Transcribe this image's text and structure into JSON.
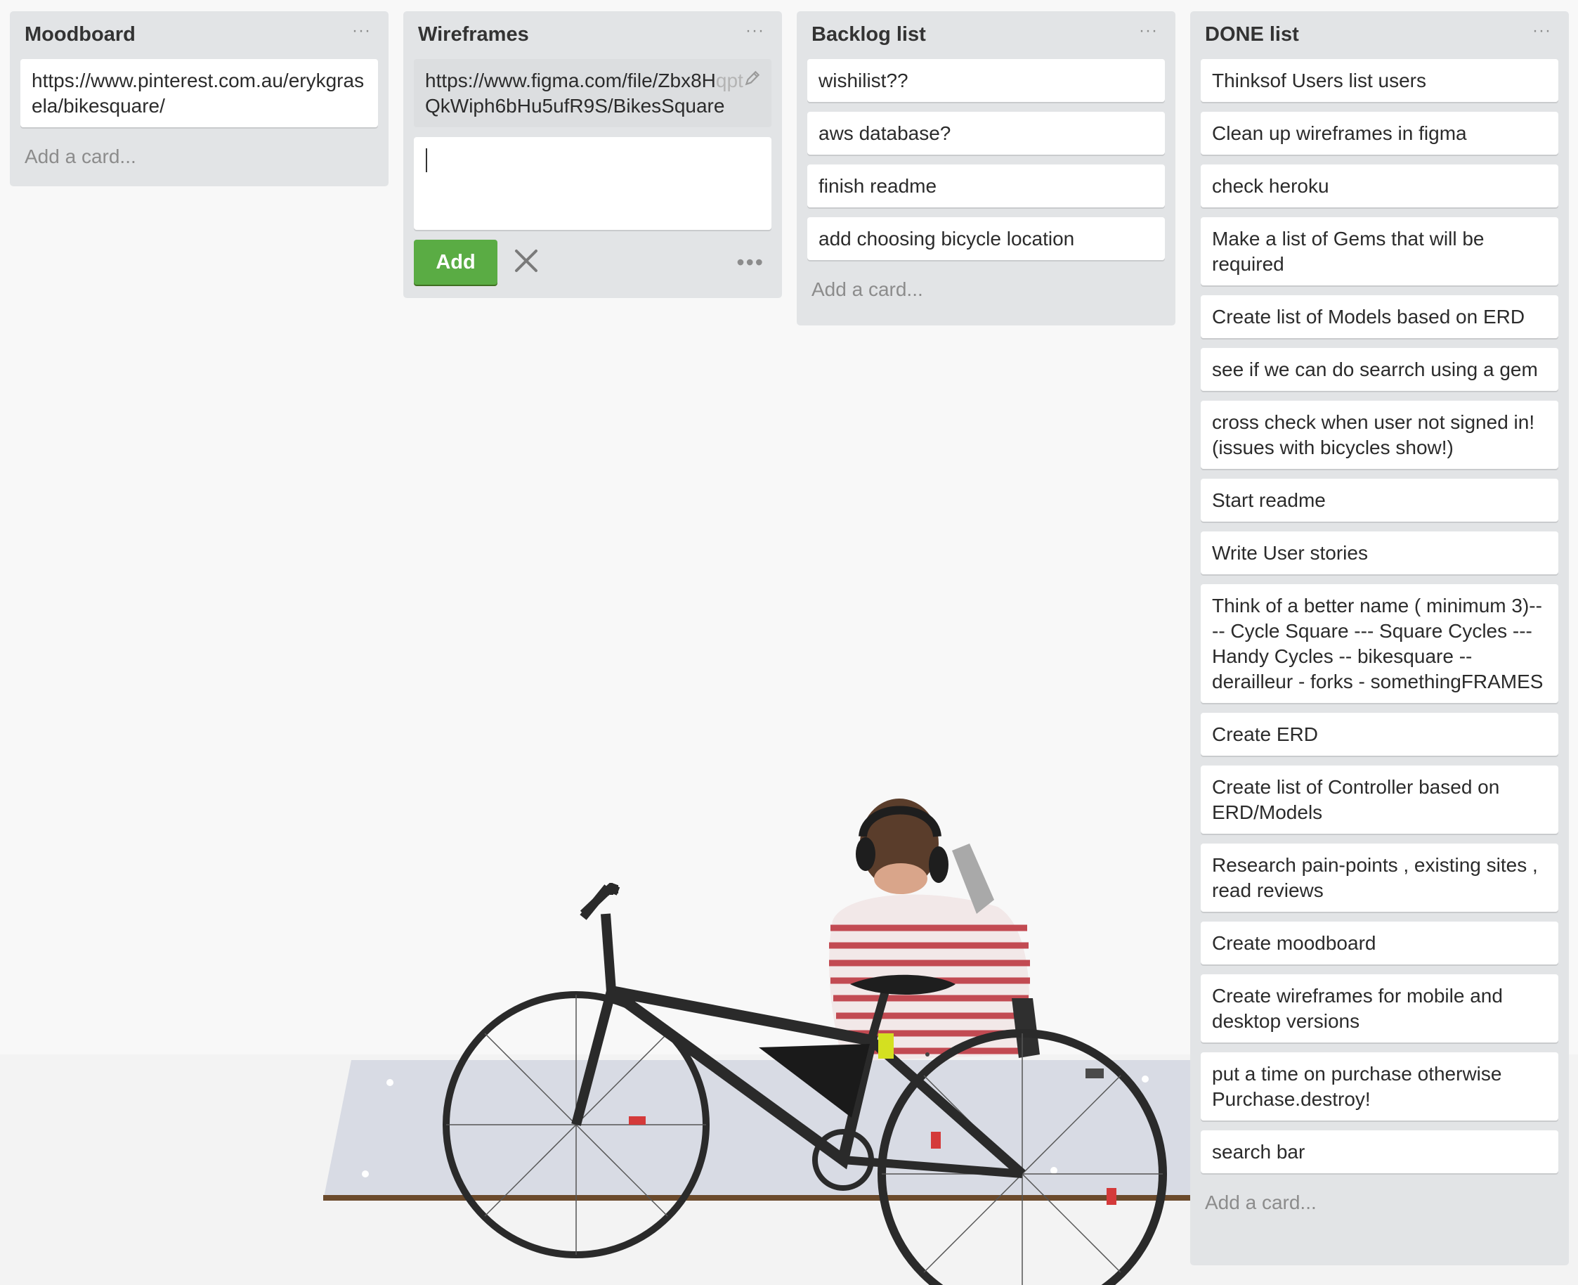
{
  "lists": [
    {
      "title": "Moodboard",
      "menu_icon": "ellipsis-icon",
      "cards": [
        "https://www.pinterest.com.au/erykgrasela/bikesquare/"
      ],
      "add_card_label": "Add a card..."
    },
    {
      "title": "Wireframes",
      "menu_icon": "ellipsis-icon",
      "cards": [
        "https://www.figma.com/file/Zbx8HqptQkWiph6bHu5ufR9S/BikesSquare"
      ],
      "editing_card_line1": "https://www.figma.com/file/Zbx8H",
      "editing_card_line1_faded": "qpt",
      "editing_card_line2": "QkWiph6bHu5ufR9S/BikesSquare",
      "composer": {
        "value": "",
        "add_button_label": "Add",
        "close_icon": "close-icon",
        "more_icon": "ellipsis-icon"
      }
    },
    {
      "title": "Backlog list",
      "menu_icon": "ellipsis-icon",
      "cards": [
        "wishilist??",
        "aws database?",
        "finish readme",
        "add choosing bicycle location"
      ],
      "add_card_label": "Add a card..."
    },
    {
      "title": "DONE list",
      "menu_icon": "ellipsis-icon",
      "cards": [
        "Thinksof Users list users",
        "Clean up wireframes in figma",
        "check heroku",
        "Make a list of Gems that will be required",
        "Create list of Models based on ERD",
        "see if we can do searrch using a gem",
        "cross check when user not signed in! (issues with bicycles show!)",
        "Start readme",
        "Write User stories",
        "Think of a better name ( minimum 3)---- Cycle Square --- Square Cycles --- Handy Cycles -- bikesquare -- derailleur - forks - somethingFRAMES",
        "Create ERD",
        "Create list of Controller based on ERD/Models",
        "Research pain-points , existing sites , read reviews",
        "Create moodboard",
        "Create wireframes for mobile and desktop versions",
        "put a time on purchase otherwise Purchase.destroy!",
        "search bar"
      ],
      "add_card_label": "Add a card..."
    }
  ],
  "background": {
    "description_icon": "person-with-bicycle-photo",
    "colors": {
      "wall": "#f7f7f7",
      "board": "#d8dbe4",
      "shirt_stripe": "#c24a52",
      "bike_frame": "#2a2a2a"
    }
  },
  "colors": {
    "list_bg": "#e2e4e6",
    "card_bg": "#ffffff",
    "add_button": "#5aac44",
    "muted_text": "#8c8c8c"
  }
}
